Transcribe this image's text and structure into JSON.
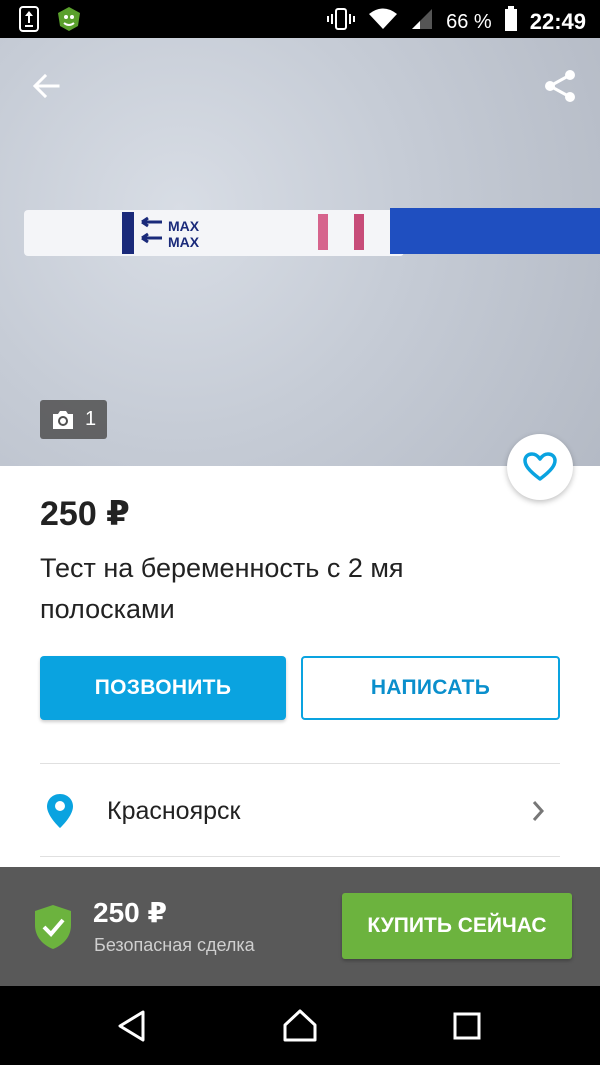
{
  "status_bar": {
    "battery_percent": "66 %",
    "time": "22:49"
  },
  "photo": {
    "count": "1",
    "strip_labels": [
      "MAX",
      "MAX"
    ]
  },
  "listing": {
    "price": "250 ₽",
    "title": "Тест на беременность с 2 мя полосками"
  },
  "actions": {
    "call_label": "ПОЗВОНИТЬ",
    "write_label": "НАПИСАТЬ"
  },
  "location": {
    "city": "Красноярск"
  },
  "buy_bar": {
    "price": "250 ₽",
    "subtitle": "Безопасная сделка",
    "buy_label": "КУПИТЬ СЕЙЧАС"
  },
  "colors": {
    "accent_blue": "#0aa3e0",
    "buy_green": "#6cb33e",
    "buybar_bg": "#595959"
  },
  "icons": {
    "back": "arrow-left-icon",
    "share": "share-icon",
    "camera": "camera-icon",
    "favorite": "heart-icon",
    "location": "map-pin-icon",
    "chevron": "chevron-right-icon",
    "secure": "shield-check-icon"
  }
}
